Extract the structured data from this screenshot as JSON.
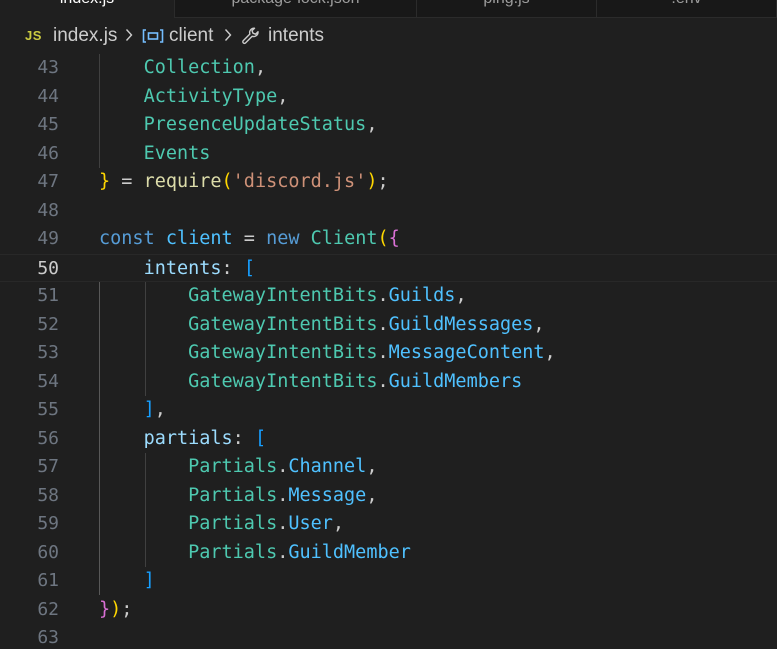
{
  "tabs": [
    {
      "label": "index.js",
      "active": true
    },
    {
      "label": "package-lock.json",
      "active": false
    },
    {
      "label": "ping.js",
      "active": false
    },
    {
      "label": ".env",
      "active": false
    }
  ],
  "breadcrumb": {
    "file_badge": "JS",
    "file": "index.js",
    "symbol_1": "client",
    "symbol_2": "intents"
  },
  "editor": {
    "current_line": 50,
    "lines": [
      {
        "n": "43",
        "tokens": [
          {
            "t": "    "
          },
          {
            "t": "Collection",
            "c": "type"
          },
          {
            "t": ","
          }
        ]
      },
      {
        "n": "44",
        "tokens": [
          {
            "t": "    "
          },
          {
            "t": "ActivityType",
            "c": "type"
          },
          {
            "t": ","
          }
        ]
      },
      {
        "n": "45",
        "tokens": [
          {
            "t": "    "
          },
          {
            "t": "PresenceUpdateStatus",
            "c": "type"
          },
          {
            "t": ","
          }
        ]
      },
      {
        "n": "46",
        "tokens": [
          {
            "t": "    "
          },
          {
            "t": "Events",
            "c": "type"
          }
        ]
      },
      {
        "n": "47",
        "tokens": [
          {
            "t": "}",
            "c": "b1"
          },
          {
            "t": " = "
          },
          {
            "t": "require",
            "c": "fn"
          },
          {
            "t": "(",
            "c": "b1"
          },
          {
            "t": "'discord.js'",
            "c": "str"
          },
          {
            "t": ")",
            "c": "b1"
          },
          {
            "t": ";"
          }
        ]
      },
      {
        "n": "48",
        "tokens": []
      },
      {
        "n": "49",
        "tokens": [
          {
            "t": "const",
            "c": "kw"
          },
          {
            "t": " "
          },
          {
            "t": "client",
            "c": "const"
          },
          {
            "t": " = "
          },
          {
            "t": "new",
            "c": "kw"
          },
          {
            "t": " "
          },
          {
            "t": "Client",
            "c": "type"
          },
          {
            "t": "(",
            "c": "b1"
          },
          {
            "t": "{",
            "c": "b2"
          }
        ]
      },
      {
        "n": "50",
        "tokens": [
          {
            "t": "    "
          },
          {
            "t": "intents",
            "c": "var"
          },
          {
            "t": ": "
          },
          {
            "t": "[",
            "c": "b3"
          }
        ]
      },
      {
        "n": "51",
        "tokens": [
          {
            "t": "        "
          },
          {
            "t": "GatewayIntentBits",
            "c": "type"
          },
          {
            "t": "."
          },
          {
            "t": "Guilds",
            "c": "const"
          },
          {
            "t": ","
          }
        ]
      },
      {
        "n": "52",
        "tokens": [
          {
            "t": "        "
          },
          {
            "t": "GatewayIntentBits",
            "c": "type"
          },
          {
            "t": "."
          },
          {
            "t": "GuildMessages",
            "c": "const"
          },
          {
            "t": ","
          }
        ]
      },
      {
        "n": "53",
        "tokens": [
          {
            "t": "        "
          },
          {
            "t": "GatewayIntentBits",
            "c": "type"
          },
          {
            "t": "."
          },
          {
            "t": "MessageContent",
            "c": "const"
          },
          {
            "t": ","
          }
        ]
      },
      {
        "n": "54",
        "tokens": [
          {
            "t": "        "
          },
          {
            "t": "GatewayIntentBits",
            "c": "type"
          },
          {
            "t": "."
          },
          {
            "t": "GuildMembers",
            "c": "const"
          }
        ]
      },
      {
        "n": "55",
        "tokens": [
          {
            "t": "    "
          },
          {
            "t": "]",
            "c": "b3"
          },
          {
            "t": ","
          }
        ]
      },
      {
        "n": "56",
        "tokens": [
          {
            "t": "    "
          },
          {
            "t": "partials",
            "c": "var"
          },
          {
            "t": ": "
          },
          {
            "t": "[",
            "c": "b3"
          }
        ]
      },
      {
        "n": "57",
        "tokens": [
          {
            "t": "        "
          },
          {
            "t": "Partials",
            "c": "type"
          },
          {
            "t": "."
          },
          {
            "t": "Channel",
            "c": "const"
          },
          {
            "t": ","
          }
        ]
      },
      {
        "n": "58",
        "tokens": [
          {
            "t": "        "
          },
          {
            "t": "Partials",
            "c": "type"
          },
          {
            "t": "."
          },
          {
            "t": "Message",
            "c": "const"
          },
          {
            "t": ","
          }
        ]
      },
      {
        "n": "59",
        "tokens": [
          {
            "t": "        "
          },
          {
            "t": "Partials",
            "c": "type"
          },
          {
            "t": "."
          },
          {
            "t": "User",
            "c": "const"
          },
          {
            "t": ","
          }
        ]
      },
      {
        "n": "60",
        "tokens": [
          {
            "t": "        "
          },
          {
            "t": "Partials",
            "c": "type"
          },
          {
            "t": "."
          },
          {
            "t": "GuildMember",
            "c": "const"
          }
        ]
      },
      {
        "n": "61",
        "tokens": [
          {
            "t": "    "
          },
          {
            "t": "]",
            "c": "b3"
          }
        ]
      },
      {
        "n": "62",
        "tokens": [
          {
            "t": "}",
            "c": "b2"
          },
          {
            "t": ")",
            "c": "b1"
          },
          {
            "t": ";"
          }
        ]
      },
      {
        "n": "63",
        "tokens": []
      }
    ]
  },
  "colors": {
    "background": "#1f1f1f",
    "type": "#4ec9b0",
    "keyword": "#569cd6",
    "variable": "#9cdcfe",
    "constant": "#4fc1ff",
    "function": "#dcdcaa",
    "string": "#ce9178",
    "bracket_1": "#ffd700",
    "bracket_2": "#da70d6",
    "bracket_3": "#179fff"
  }
}
